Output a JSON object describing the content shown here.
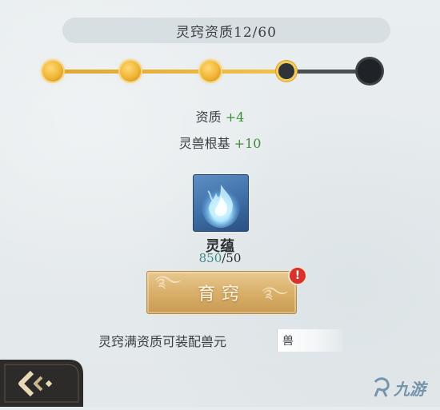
{
  "header": {
    "title": "灵窍资质12/60"
  },
  "progress": {
    "nodes": [
      "done",
      "done",
      "done",
      "current",
      "locked"
    ],
    "colors": {
      "done": "#f0b535",
      "track": "#e0a52c",
      "locked": "#1f2226"
    }
  },
  "stats": [
    {
      "label": "资质",
      "value": "+4"
    },
    {
      "label": "灵兽根基",
      "value": "+10"
    }
  ],
  "item": {
    "icon": "blue-spirit-flame-icon",
    "name": "灵蕴",
    "have": "850",
    "need": "/50"
  },
  "action": {
    "label": "育窍",
    "alert": "!"
  },
  "footer": {
    "text": "灵窍满资质可装配兽元",
    "tag": "兽"
  },
  "watermark": {
    "icon": "jiuyou-logo-icon",
    "text": "九游"
  }
}
